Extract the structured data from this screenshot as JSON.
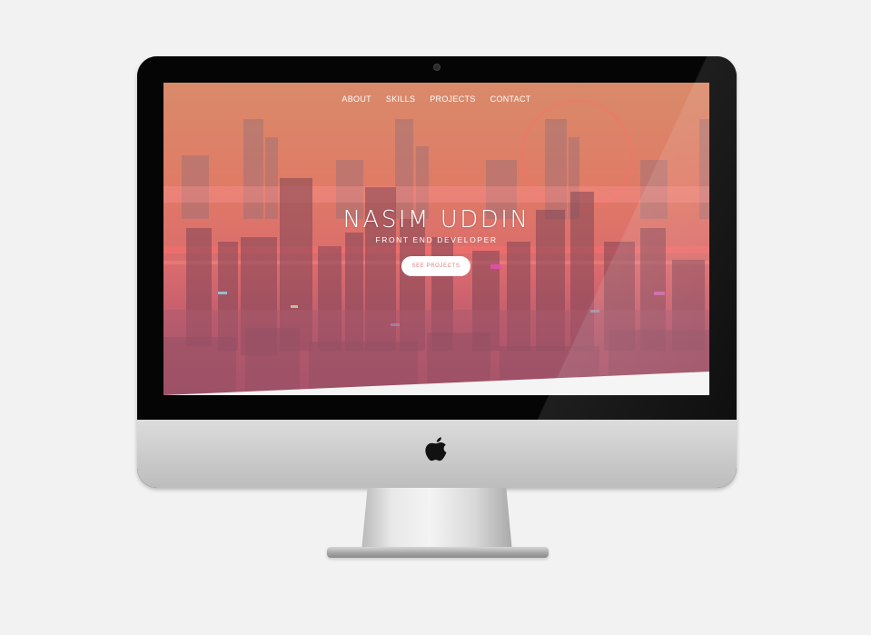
{
  "site": {
    "nav": [
      {
        "label": "ABOUT"
      },
      {
        "label": "SKILLS"
      },
      {
        "label": "PROJECTS"
      },
      {
        "label": "CONTACT"
      }
    ],
    "hero": {
      "title": "NASIM UDDIN",
      "subtitle": "FRONT END DEVELOPER",
      "cta_label": "SEE PROJECTS"
    }
  },
  "icons": {
    "logo": "apple-logo-icon",
    "camera": "camera-icon"
  },
  "colors": {
    "background": "#f2f2f2",
    "hero_top": "#d98a6a",
    "hero_bottom": "#a34d66",
    "cta_text": "#e07a7a",
    "bezel": "#050505"
  }
}
